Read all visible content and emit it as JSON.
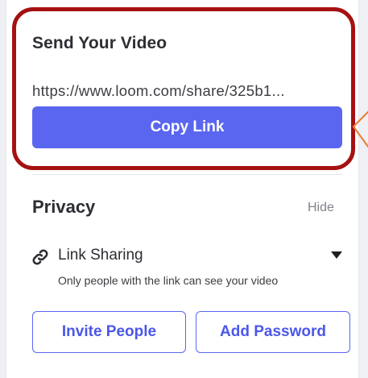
{
  "send": {
    "title": "Send Your Video",
    "share_url": "https://www.loom.com/share/325b1...",
    "copy_label": "Copy Link"
  },
  "privacy": {
    "heading": "Privacy",
    "hide_label": "Hide",
    "link_sharing": {
      "label": "Link Sharing",
      "icon": "link-icon",
      "description": "Only people with the link can see your video"
    }
  },
  "actions": {
    "invite_label": "Invite People",
    "password_label": "Add Password"
  },
  "colors": {
    "primary": "#5a66f0",
    "highlight": "#a51111",
    "arrow": "#e8833a",
    "muted": "#80838a"
  }
}
